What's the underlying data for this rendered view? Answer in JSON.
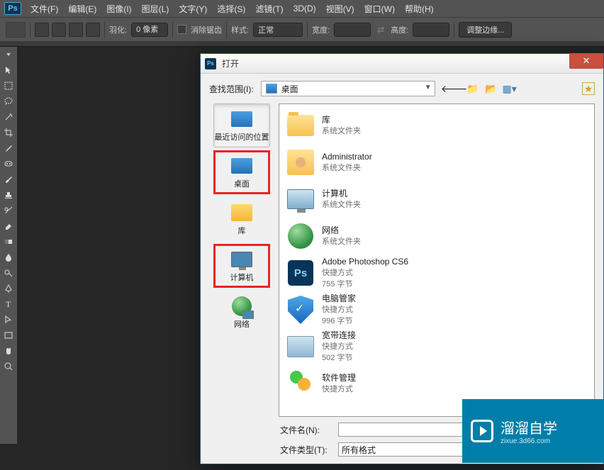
{
  "menubar": {
    "logo": "Ps",
    "items": [
      "文件(F)",
      "编辑(E)",
      "图像(I)",
      "图层(L)",
      "文字(Y)",
      "选择(S)",
      "滤镜(T)",
      "3D(D)",
      "视图(V)",
      "窗口(W)",
      "帮助(H)"
    ]
  },
  "optbar": {
    "feather_label": "羽化:",
    "feather_value": "0 像素",
    "antialias_label": "消除锯齿",
    "style_label": "样式:",
    "style_value": "正常",
    "width_label": "宽度:",
    "height_label": "高度:",
    "refine_edge": "调整边缘..."
  },
  "dialog": {
    "title": "打开",
    "look_in_label": "查找范围(I):",
    "look_in_value": "桌面",
    "sidebar": [
      {
        "label": "最近访问的位置"
      },
      {
        "label": "桌面"
      },
      {
        "label": "库"
      },
      {
        "label": "计算机"
      },
      {
        "label": "网络"
      }
    ],
    "files": [
      {
        "name": "库",
        "sub": "系统文件夹",
        "type": "folder"
      },
      {
        "name": "Administrator",
        "sub": "系统文件夹",
        "type": "user"
      },
      {
        "name": "计算机",
        "sub": "系统文件夹",
        "type": "computer"
      },
      {
        "name": "网络",
        "sub": "系统文件夹",
        "type": "network"
      },
      {
        "name": "Adobe Photoshop CS6",
        "sub": "快捷方式",
        "size": "755 字节",
        "type": "ps"
      },
      {
        "name": "电脑管家",
        "sub": "快捷方式",
        "size": "996 字节",
        "type": "shield"
      },
      {
        "name": "宽带连接",
        "sub": "快捷方式",
        "size": "502 字节",
        "type": "broadband"
      },
      {
        "name": "软件管理",
        "sub": "快捷方式",
        "size": "",
        "type": "soft"
      }
    ],
    "filename_label": "文件名(N):",
    "filename_value": "",
    "filetype_label": "文件类型(T):",
    "filetype_value": "所有格式"
  },
  "watermark": {
    "title": "溜溜自学",
    "sub": "zixue.3d66.com"
  }
}
